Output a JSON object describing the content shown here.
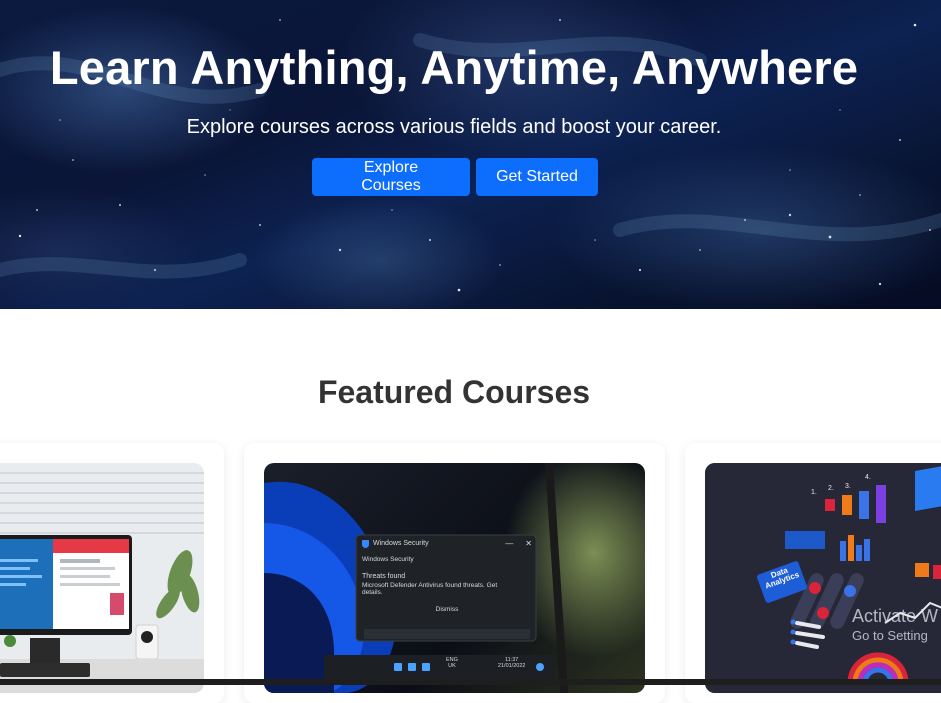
{
  "hero": {
    "title": "Learn Anything, Anytime, Anywhere",
    "subtitle": "Explore courses across various fields and boost your career.",
    "buttons": {
      "explore_label": "Explore Courses",
      "start_label": "Get Started"
    }
  },
  "featured": {
    "title": "Featured Courses"
  },
  "card2_popup": {
    "app": "Windows Security",
    "heading": "Windows Security",
    "line1": "Threats found",
    "line2": "Microsoft Defender Antivirus found threats. Get",
    "line3": "details.",
    "dismiss": "Dismiss",
    "taskbar_lang1": "ENG",
    "taskbar_lang2": "UK",
    "taskbar_time": "11:37",
    "taskbar_date": "21/01/2022"
  },
  "card3_image": {
    "badge_line1": "Data",
    "badge_line2": "Analytics",
    "step1": "1.",
    "step2": "2.",
    "step3": "3.",
    "step4": "4."
  },
  "watermark": {
    "line1": "Activate W",
    "line2": "Go to Setting"
  },
  "colors": {
    "primary_button": "#0d6efd",
    "heading_text": "#333333"
  }
}
